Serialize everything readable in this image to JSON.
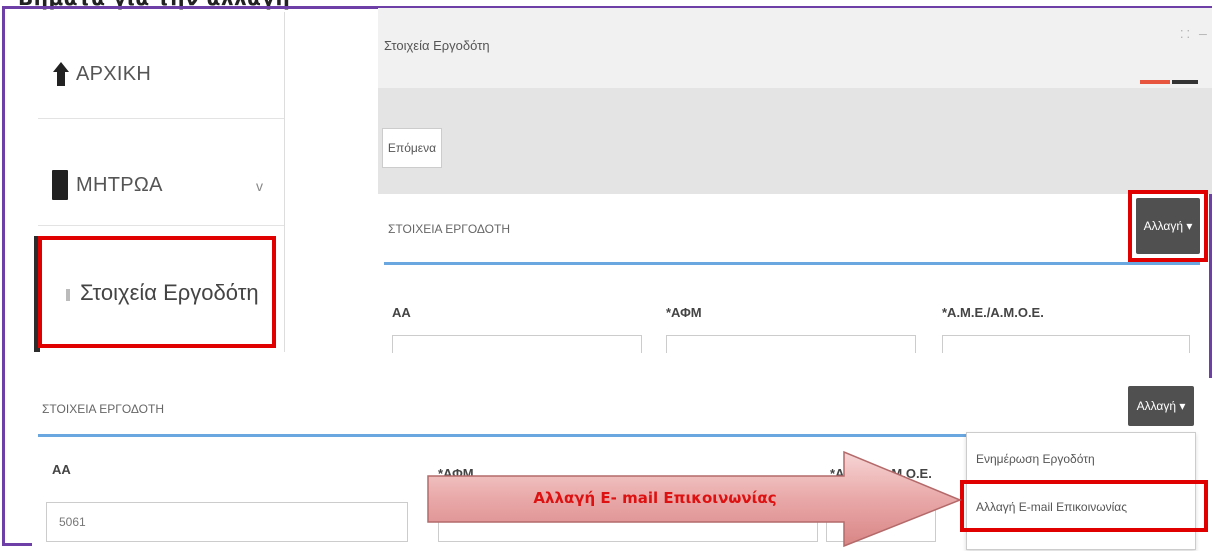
{
  "heading_fragment": "Βήματα για την αλλαγή",
  "sidebar": {
    "home_label": "ΑΡΧΙΚΗ",
    "registers_label": "ΜΗΤΡΩΑ",
    "registers_chevron": "v",
    "employer_label": "Στοιχεία Εργοδότη"
  },
  "top_panel": {
    "header_title": "Στοιχεία Εργοδότη",
    "header_controls": "⁚⁚ ─",
    "tab_label": "Επόμενα",
    "section_title": "ΣΤΟΙΧΕΙΑ ΕΡΓΟΔΟΤΗ",
    "change_button": "Αλλαγή ▾",
    "fields": [
      "ΑΑ",
      "*ΑΦΜ",
      "*Α.Μ.Ε./Α.Μ.Ο.Ε."
    ]
  },
  "bottom_panel": {
    "section_title": "ΣΤΟΙΧΕΙΑ ΕΡΓΟΔΟΤΗ",
    "change_button": "Αλλαγή ▾",
    "fields": [
      "ΑΑ",
      "*ΑΦΜ",
      "*Α.Μ.Ε./Α.Μ.Ο.Ε."
    ],
    "aa_value": "5061",
    "dropdown": [
      "Ενημέρωση Εργοδότη",
      "Αλλαγή E-mail Επικοινωνίας"
    ]
  },
  "callout": {
    "label": "Αλλαγή Ε- mail  Επικοινωνίας"
  },
  "colors": {
    "frame": "#6f3fa8",
    "highlight": "#e00000",
    "accent_blue": "#6aa6e0",
    "button_dark": "#505050"
  }
}
